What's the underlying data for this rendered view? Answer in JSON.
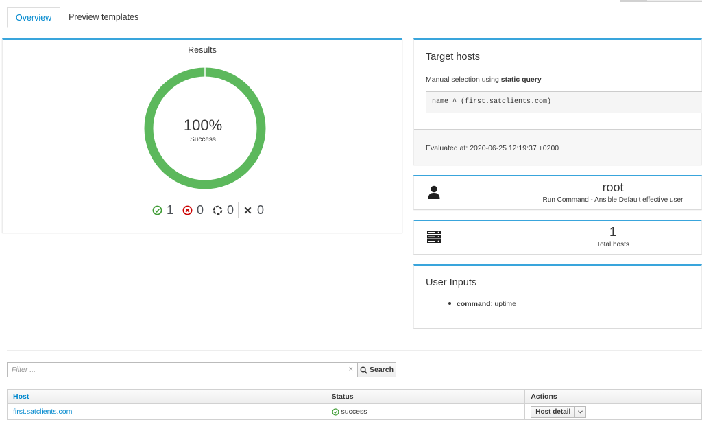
{
  "tabs": [
    {
      "label": "Overview",
      "active": true
    },
    {
      "label": "Preview templates",
      "active": false
    }
  ],
  "results": {
    "title": "Results",
    "percent": "100%",
    "percent_value": 100,
    "subtitle": "Success",
    "counts": [
      {
        "icon": "check-circle-icon",
        "value": "1",
        "color": "#3f9c35"
      },
      {
        "icon": "error-circle-icon",
        "value": "0",
        "color": "#cc0000"
      },
      {
        "icon": "pending-icon",
        "value": "0",
        "color": "#363636"
      },
      {
        "icon": "cancelled-icon",
        "value": "0",
        "color": "#363636"
      }
    ]
  },
  "target_hosts": {
    "title": "Target hosts",
    "description_prefix": "Manual selection using ",
    "description_bold": "static query",
    "query": "name ^ (first.satclients.com)",
    "evaluated": "Evaluated at: 2020-06-25 12:19:37 +0200"
  },
  "effective_user": {
    "icon": "user-icon",
    "value": "root",
    "label": "Run Command - Ansible Default effective user"
  },
  "total_hosts": {
    "icon": "server-icon",
    "value": "1",
    "label": "Total hosts"
  },
  "user_inputs": {
    "title": "User Inputs",
    "items": [
      {
        "key": "command",
        "value": ": uptime"
      }
    ]
  },
  "filter": {
    "placeholder": "Filter ...",
    "clear": "×",
    "search_label": "Search"
  },
  "table": {
    "headers": [
      "Host",
      "Status",
      "Actions"
    ],
    "rows": [
      {
        "host": "first.satclients.com",
        "status": "success",
        "action": "Host detail"
      }
    ]
  },
  "colors": {
    "accent": "#0088ce",
    "card_border": "#39a5dc",
    "success": "#3f9c35",
    "donut": "#5cb85c"
  }
}
